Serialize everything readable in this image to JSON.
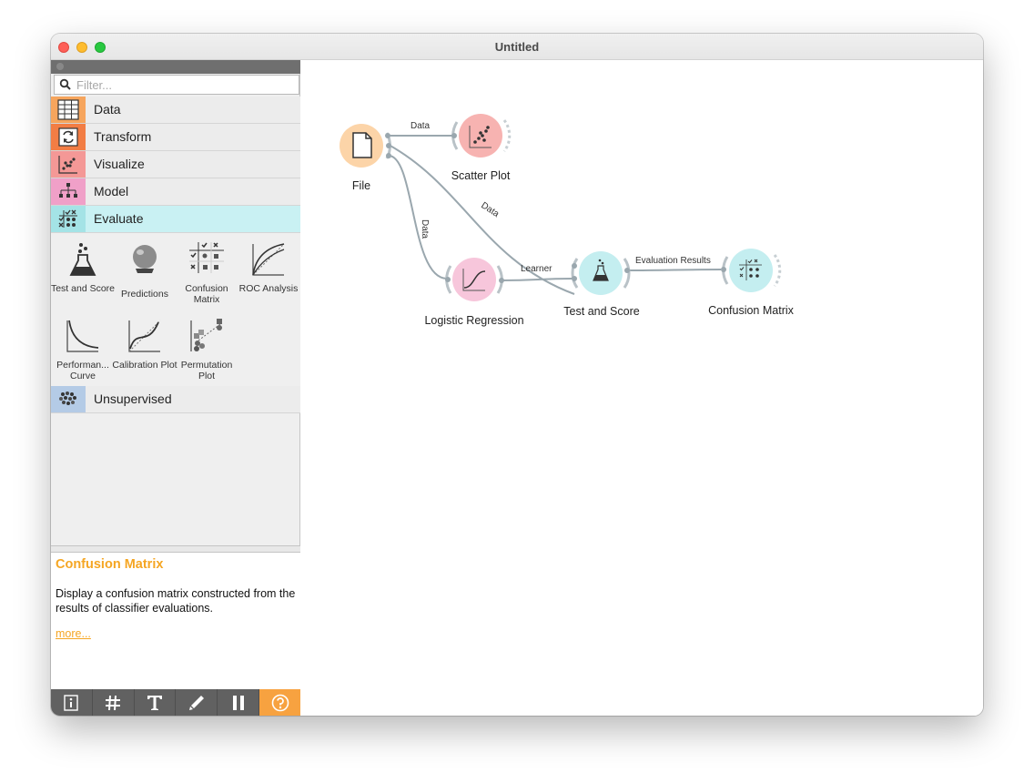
{
  "window": {
    "title": "Untitled"
  },
  "sidebar": {
    "filter": {
      "placeholder": "Filter..."
    },
    "categories": [
      {
        "label": "Data",
        "color": "#f6a55d",
        "icon": "table-icon"
      },
      {
        "label": "Transform",
        "color": "#f27d44",
        "icon": "transform-icon"
      },
      {
        "label": "Visualize",
        "color": "#f49896",
        "icon": "scatter-icon"
      },
      {
        "label": "Model",
        "color": "#f0a0c8",
        "icon": "tree-icon"
      },
      {
        "label": "Evaluate",
        "color": "#a4e3e6",
        "icon": "evaluate-icon",
        "active": true
      },
      {
        "label": "Unsupervised",
        "color": "#b4cbe6",
        "icon": "cluster-icon"
      }
    ],
    "evaluate_widgets": [
      {
        "label": "Test and Score",
        "icon": "flask-icon"
      },
      {
        "label": "Predictions",
        "icon": "crystal-ball-icon"
      },
      {
        "label": "Confusion Matrix",
        "icon": "confusion-matrix-icon"
      },
      {
        "label": "ROC Analysis",
        "icon": "roc-curve-icon"
      },
      {
        "label": "Performan... Curve",
        "icon": "performance-curve-icon"
      },
      {
        "label": "Calibration Plot",
        "icon": "calibration-plot-icon"
      },
      {
        "label": "Permutation Plot",
        "icon": "permutation-plot-icon"
      }
    ],
    "help": {
      "title": "Confusion Matrix",
      "description": "Display a confusion matrix constructed from the results of classifier evaluations.",
      "more": "more..."
    },
    "toolbar": [
      "info-icon",
      "grid-icon",
      "text-icon",
      "pen-icon",
      "pause-icon",
      "help-icon"
    ]
  },
  "canvas": {
    "nodes": [
      {
        "id": "file",
        "label": "File",
        "color": "#fcd4a8"
      },
      {
        "id": "scatter",
        "label": "Scatter Plot",
        "color": "#f7b3b1"
      },
      {
        "id": "logreg",
        "label": "Logistic Regression",
        "color": "#f7c6db"
      },
      {
        "id": "testscore",
        "label": "Test and Score",
        "color": "#c4eef0"
      },
      {
        "id": "confusion",
        "label": "Confusion Matrix",
        "color": "#c4eef0"
      }
    ],
    "links": [
      {
        "label": "Data"
      },
      {
        "label": "Data"
      },
      {
        "label": "Data"
      },
      {
        "label": "Learner"
      },
      {
        "label": "Evaluation Results"
      }
    ]
  }
}
